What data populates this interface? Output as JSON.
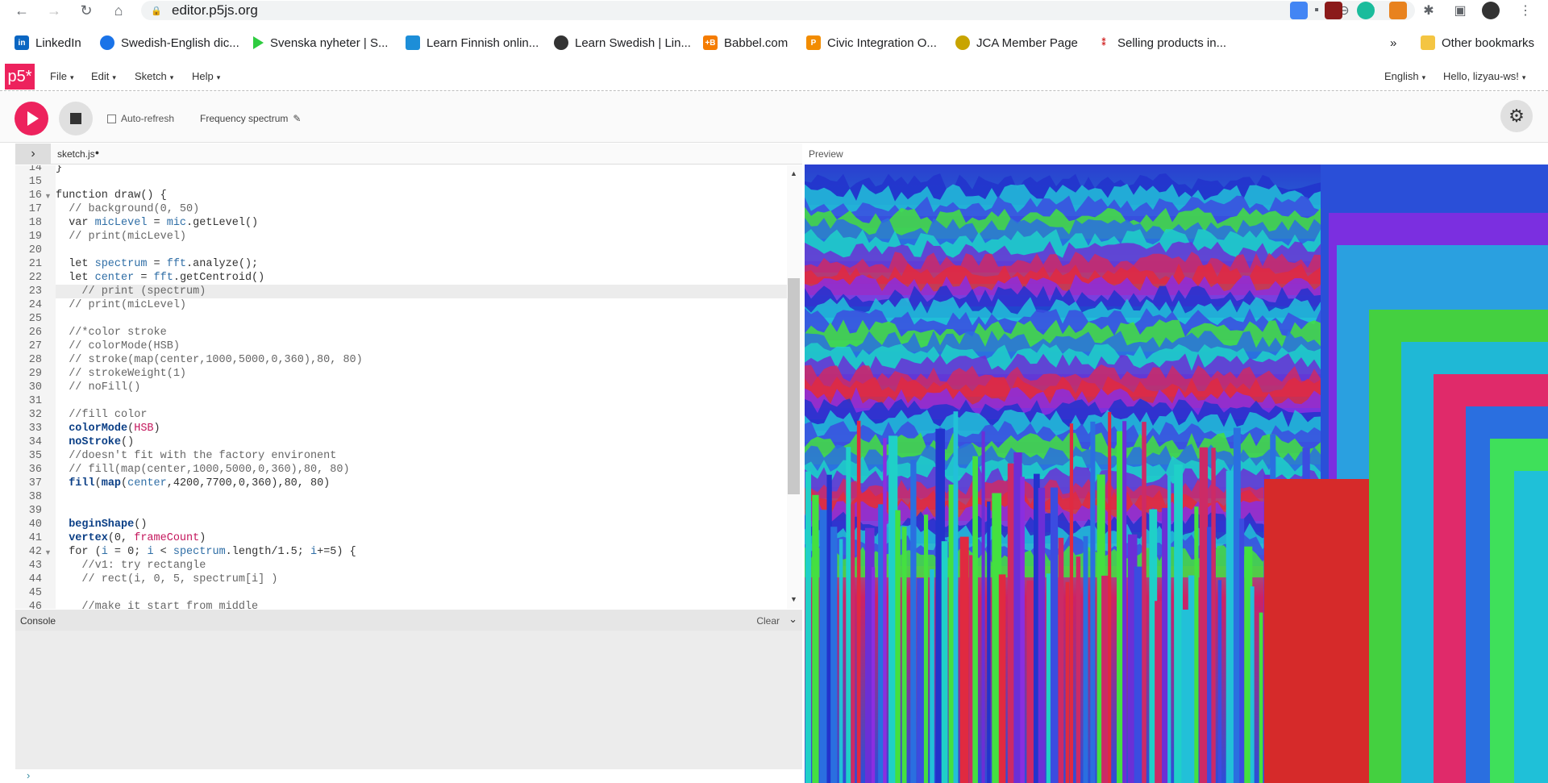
{
  "browser": {
    "url": "editor.p5js.org",
    "bookmarks": [
      "LinkedIn",
      "Swedish-English dic...",
      "Svenska nyheter | S...",
      "Learn Finnish onlin...",
      "Learn Swedish | Lin...",
      "Babbel.com",
      "Civic Integration O...",
      "JCA Member Page",
      "Selling products in..."
    ],
    "more_bookmarks": "»",
    "other_bookmarks": "Other bookmarks"
  },
  "p5": {
    "logo": "p5*",
    "menus": [
      "File",
      "Edit",
      "Sketch",
      "Help"
    ],
    "language": "English",
    "user": "Hello, lizyau-ws!",
    "auto_refresh": "Auto-refresh",
    "sketch_name": "Frequency spectrum",
    "file_tab": "sketch.js",
    "preview_label": "Preview",
    "console_label": "Console",
    "console_clear": "Clear",
    "console_prompt": "›"
  },
  "editor": {
    "lines": [
      {
        "n": "14",
        "t": "}"
      },
      {
        "n": "15",
        "t": ""
      },
      {
        "n": "16",
        "t": "function draw() {",
        "fold": true
      },
      {
        "n": "17",
        "t": "  // background(0, 50)"
      },
      {
        "n": "18",
        "t": "  var micLevel = mic.getLevel()"
      },
      {
        "n": "19",
        "t": "  // print(micLevel)"
      },
      {
        "n": "20",
        "t": ""
      },
      {
        "n": "21",
        "t": "  let spectrum = fft.analyze();"
      },
      {
        "n": "22",
        "t": "  let center = fft.getCentroid()"
      },
      {
        "n": "23",
        "t": "    // print (spectrum)",
        "active": true
      },
      {
        "n": "24",
        "t": "  // print(micLevel)"
      },
      {
        "n": "25",
        "t": ""
      },
      {
        "n": "26",
        "t": "  //*color stroke"
      },
      {
        "n": "27",
        "t": "  // colorMode(HSB)"
      },
      {
        "n": "28",
        "t": "  // stroke(map(center,1000,5000,0,360),80, 80)"
      },
      {
        "n": "29",
        "t": "  // strokeWeight(1)"
      },
      {
        "n": "30",
        "t": "  // noFill()"
      },
      {
        "n": "31",
        "t": ""
      },
      {
        "n": "32",
        "t": "  //fill color"
      },
      {
        "n": "33",
        "t": "  colorMode(HSB)"
      },
      {
        "n": "34",
        "t": "  noStroke()"
      },
      {
        "n": "35",
        "t": "  //doesn't fit with the factory environent"
      },
      {
        "n": "36",
        "t": "  // fill(map(center,1000,5000,0,360),80, 80)"
      },
      {
        "n": "37",
        "t": "  fill(map(center,4200,7700,0,360),80, 80)"
      },
      {
        "n": "38",
        "t": ""
      },
      {
        "n": "39",
        "t": ""
      },
      {
        "n": "40",
        "t": "  beginShape()"
      },
      {
        "n": "41",
        "t": "  vertex(0, frameCount)"
      },
      {
        "n": "42",
        "t": "  for (i = 0; i < spectrum.length/1.5; i+=5) {",
        "fold": true
      },
      {
        "n": "43",
        "t": "    //v1: try rectangle"
      },
      {
        "n": "44",
        "t": "    // rect(i, 0, 5, spectrum[i] )"
      },
      {
        "n": "45",
        "t": ""
      },
      {
        "n": "46",
        "t": "    //make it start from middle"
      }
    ]
  },
  "colors": {
    "p5_pink": "#ed225d"
  }
}
